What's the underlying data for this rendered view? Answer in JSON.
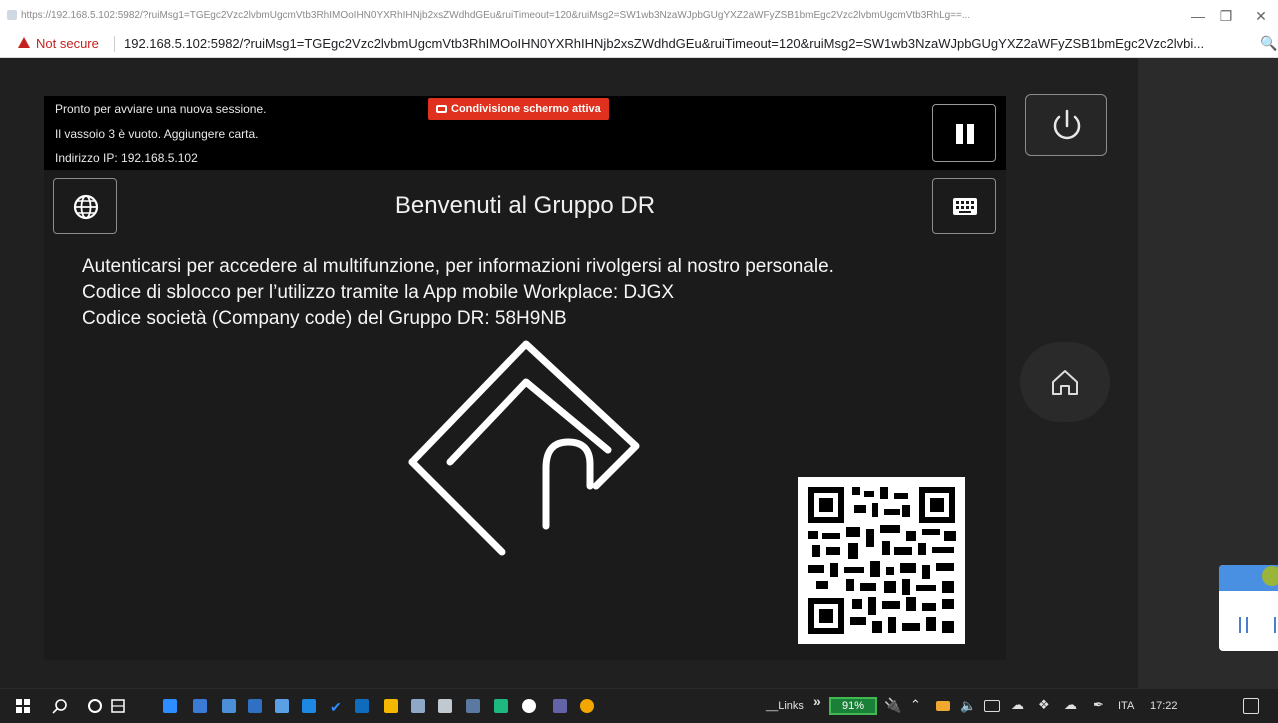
{
  "browser": {
    "tab_title": "https://192.168.5.102:5982/?ruiMsg1=TGEgc2Vzc2lvbmUgcmVtb3RhIMOoIHN0YXRhIHNjb2xsZWdhdGEu&ruiTimeout=120&ruiMsg2=SW1wb3NzaWJpbGUgYXZ2aWFyZSB1bmEgc2Vzc2lvbmUgcmVtb3RhLg==...",
    "security_label": "Not secure",
    "url": "192.168.5.102:5982/?ruiMsg1=TGEgc2Vzc2lvbmUgcmVtb3RhIMOoIHN0YXRhIHNjb2xsZWdhdGEu&ruiTimeout=120&ruiMsg2=SW1wb3NzaWJpbGUgYXZ2aWFyZSB1bmEgc2Vzc2lvbi..."
  },
  "device": {
    "status_lines": [
      "Pronto per avviare una nuova sessione.",
      "Il vassoio 3 è vuoto.  Aggiungere carta.",
      "Indirizzo IP: 192.168.5.102"
    ],
    "share_badge": "Condivisione schermo attiva",
    "welcome_title": "Benvenuti al Gruppo DR",
    "info_lines": [
      "Autenticarsi per accedere al multifunzione, per informazioni rivolgersi al nostro personale.",
      "Codice di sblocco per l’utilizzo tramite la App mobile Workplace: DJGX",
      "Codice società (Company code) del Gruppo DR: 58H9NB"
    ]
  },
  "icons": {
    "globe": "globe-icon",
    "keyboard": "keyboard-icon",
    "power": "power-icon",
    "home": "home-icon",
    "pause": "pause-icon",
    "card": "card-swipe-icon",
    "qr": "qr-code"
  },
  "taskbar": {
    "links_label": "__Links",
    "battery": "91%",
    "language": "ITA",
    "time": "17:22"
  },
  "colors": {
    "accent_red": "#e0301e",
    "battery_green": "#1a7f37"
  }
}
